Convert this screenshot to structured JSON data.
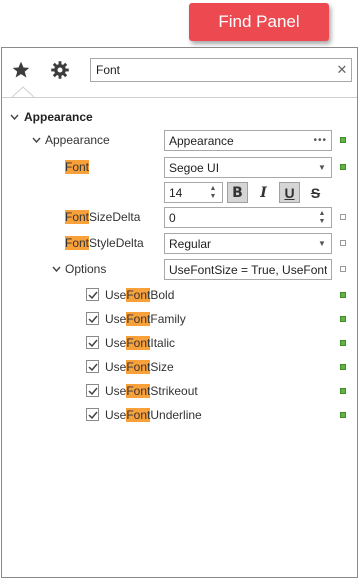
{
  "callout": {
    "label": "Find Panel"
  },
  "search": {
    "value": "Font"
  },
  "category": {
    "label": "Appearance"
  },
  "rows": {
    "appearance": {
      "label": "Appearance",
      "value": "Appearance"
    },
    "font": {
      "label_hl": "Font",
      "label_rest": "",
      "value": "Segoe UI",
      "size": "14",
      "bold": "B",
      "italic": "I",
      "underline": "U",
      "strike": "S"
    },
    "size_delta": {
      "label_hl": "Font",
      "label_rest": "SizeDelta",
      "value": "0"
    },
    "style_delta": {
      "label_hl": "Font",
      "label_rest": "StyleDelta",
      "value": "Regular"
    },
    "options": {
      "label": "Options",
      "value": "UseFontSize = True, UseFontF..."
    }
  },
  "options_items": [
    {
      "pre": "Use",
      "hl": "Font",
      "post": "Bold"
    },
    {
      "pre": "Use",
      "hl": "Font",
      "post": "Family"
    },
    {
      "pre": "Use",
      "hl": "Font",
      "post": "Italic"
    },
    {
      "pre": "Use",
      "hl": "Font",
      "post": "Size"
    },
    {
      "pre": "Use",
      "hl": "Font",
      "post": "Strikeout"
    },
    {
      "pre": "Use",
      "hl": "Font",
      "post": "Underline"
    }
  ],
  "colors": {
    "callout": "#ec4a50",
    "highlight": "#f8a03a",
    "marker_set": "#62b545"
  },
  "icons": [
    "favorites-star-icon",
    "gear-icon",
    "clear-icon",
    "chevron-down-icon",
    "ellipsis-icon",
    "dropdown-arrow-icon",
    "spin-icon",
    "check-icon"
  ]
}
